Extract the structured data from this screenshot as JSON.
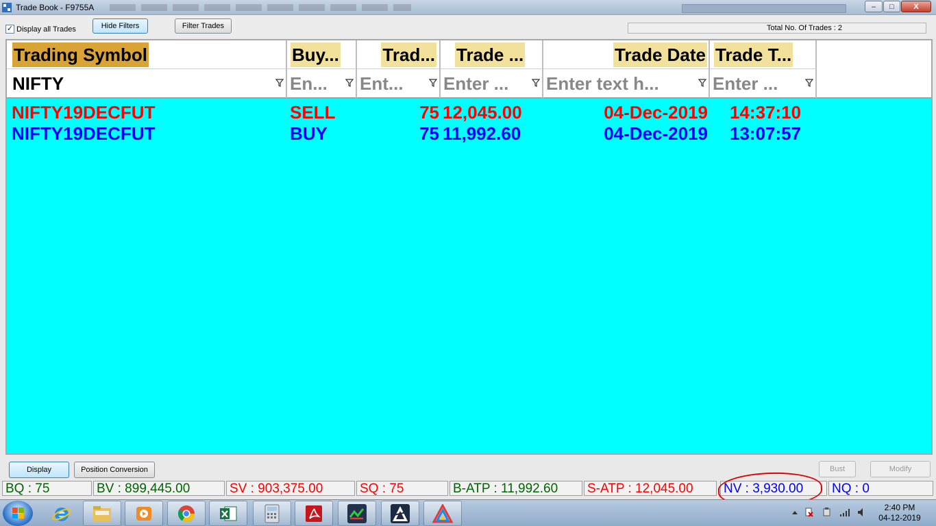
{
  "window": {
    "title": "Trade Book - F9755A",
    "controls": {
      "minimize": "–",
      "maximize": "□",
      "close": "X"
    }
  },
  "toolbar": {
    "display_all_checkbox": {
      "label": "Display all Trades",
      "checked": true,
      "mark": "✓"
    },
    "hide_filters_label": "Hide Filters",
    "filter_trades_label": "Filter Trades",
    "total_trades": "Total No. Of Trades : 2"
  },
  "grid": {
    "background": "#00ffff",
    "headers": {
      "symbol": "Trading Symbol",
      "buy_sell": "Buy...",
      "trade_qty": "Trad...",
      "trade_price": "Trade ...",
      "trade_date": "Trade Date",
      "trade_time": "Trade T..."
    },
    "filters": {
      "symbol": "NIFTY",
      "buy_sell": "En...",
      "trade_qty": "Ent...",
      "trade_price": "Enter ...",
      "trade_date": "Enter text h...",
      "trade_time": "Enter ..."
    },
    "rows": [
      {
        "symbol": "NIFTY19DECFUT",
        "side": "SELL",
        "qty": "75",
        "price": "12,045.00",
        "date": "04-Dec-2019",
        "time": "14:37:10",
        "color": "#ff0000"
      },
      {
        "symbol": "NIFTY19DECFUT",
        "side": "BUY",
        "qty": "75",
        "price": "11,992.60",
        "date": "04-Dec-2019",
        "time": "13:07:57",
        "color": "#0000ff"
      }
    ]
  },
  "actions": {
    "display_label": "Display",
    "position_conversion_label": "Position Conversion",
    "bust_label": "Bust",
    "modify_label": "Modify"
  },
  "status_bar": {
    "bq": "BQ : 75",
    "bv": "BV : 899,445.00",
    "sv": "SV : 903,375.00",
    "sq": "SQ : 75",
    "b_atp": "B-ATP : 11,992.60",
    "s_atp": "S-ATP : 12,045.00",
    "nv": "NV : 3,930.00",
    "nq": "NQ : 0",
    "colors": {
      "buy": "#006400",
      "sell": "#ff0000",
      "net": "#0000ff"
    }
  },
  "taskbar": {
    "clock_time": "2:40 PM",
    "clock_date": "04-12-2019",
    "icons": [
      "start-orb-icon",
      "internet-explorer-icon",
      "file-explorer-icon",
      "media-player-icon",
      "chrome-icon",
      "excel-icon",
      "calculator-icon",
      "pdf-reader-icon",
      "trading-app-icon",
      "trading-terminal-icon",
      "chart-app-icon"
    ]
  }
}
